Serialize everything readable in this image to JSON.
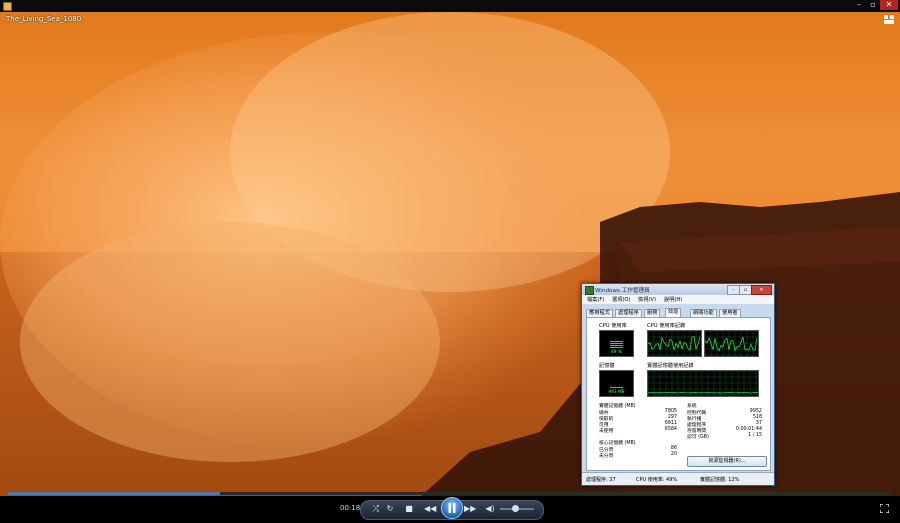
{
  "window": {
    "video_title": "The_Living_Sea_1080",
    "min_glyph": "–",
    "max_glyph": "▫",
    "close_glyph": "✕"
  },
  "player": {
    "timecode": "00:18",
    "seek_progress": 0.24,
    "volume_level": 0.45,
    "accent_color": "#4f78a8",
    "icons": [
      "shuffle-icon",
      "repeat-icon",
      "stop-icon",
      "previous-icon",
      "play-pause-icon",
      "next-icon",
      "volume-icon",
      "fullscreen-icon"
    ]
  },
  "task_manager": {
    "title": "Windows 工作管理員",
    "menu": [
      "檔案(F)",
      "選項(O)",
      "檢視(V)",
      "說明(H)"
    ],
    "tabs": [
      "應用程式",
      "處理程序",
      "服務",
      "效能",
      "網路功能",
      "使用者"
    ],
    "active_tab_index": 3,
    "cpu_usage_label": "CPU 使用率",
    "cpu_history_label": "CPU 使用率記錄",
    "cpu_percent_text": "49 %",
    "cpu_percent": 49,
    "memory_label": "記憶體",
    "memory_history_label": "實體記憶體使用記錄",
    "memory_text": "993 MB",
    "memory_fraction": 0.13,
    "physical": {
      "header": "實體記憶體 (MB)",
      "rows": [
        {
          "label": "總共",
          "value": "7805"
        },
        {
          "label": "快取的",
          "value": "297"
        },
        {
          "label": "可用",
          "value": "6811"
        },
        {
          "label": "未使用",
          "value": "6584"
        }
      ]
    },
    "kernel": {
      "header": "核心記憶體 (MB)",
      "rows": [
        {
          "label": "已分頁",
          "value": "86"
        },
        {
          "label": "未分頁",
          "value": "20"
        }
      ]
    },
    "system": {
      "header": "系統",
      "rows": [
        {
          "label": "控制代碼",
          "value": "9952"
        },
        {
          "label": "執行緒",
          "value": "518"
        },
        {
          "label": "處理程序",
          "value": "37"
        },
        {
          "label": "存留時間",
          "value": "0:00:01:44"
        },
        {
          "label": "認可 (GB)",
          "value": "1 / 15"
        }
      ]
    },
    "resource_monitor_button": "資源監視器(R)...",
    "status": {
      "processes": "處理程序: 37",
      "cpu": "CPU 使用率: 49%",
      "memory": "實體記憶體: 12%"
    },
    "graph_color": "#2ad74c"
  }
}
